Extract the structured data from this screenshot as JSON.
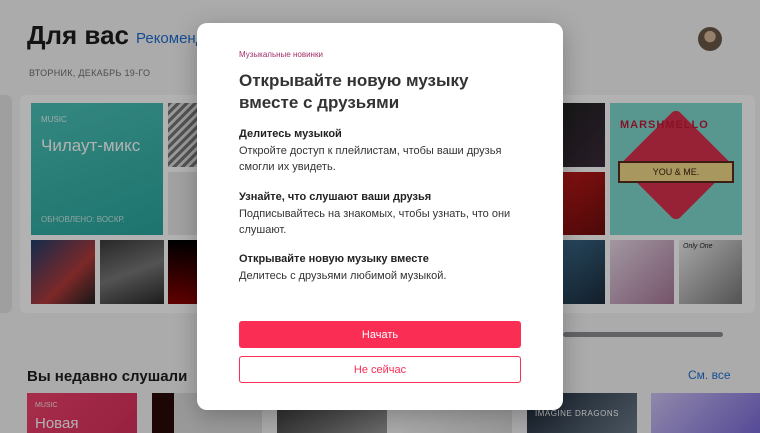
{
  "page": {
    "title": "Для вас",
    "tab_recommendations": "Рекомендации",
    "date": "ВТОРНИК, ДЕКАБРЬ 19-ГО",
    "mix": {
      "brand": "MUSIC",
      "name": "Чилаут-микс",
      "updated": "ОБНОВЛЕНО: ВОСКР."
    },
    "album_marshmello": {
      "word": "MARSHMELLO",
      "ribbon": "YOU & ME."
    },
    "album_only_one": "Only One",
    "recent_title": "Вы недавно слушали",
    "see_all": "См. все",
    "recent_mix": {
      "brand": "MUSIC",
      "name": "Новая"
    },
    "recent_band": "IMAGINE DRAGONS"
  },
  "modal": {
    "eyebrow": "Музыкальные новинки",
    "headline": "Открывайте новую музыку вместе с друзьями",
    "features": [
      {
        "title": "Делитесь музыкой",
        "desc": "Откройте доступ к плейлистам, чтобы ваши друзья смогли их увидеть."
      },
      {
        "title": "Узнайте, что слушают ваши друзья",
        "desc": "Подписывайтесь на знакомых, чтобы узнать, что они слушают."
      },
      {
        "title": "Открывайте новую музыку вместе",
        "desc": "Делитесь с друзьями любимой музыкой."
      }
    ],
    "start_label": "Начать",
    "later_label": "Не сейчас"
  },
  "colors": {
    "accent": "#fa2d55",
    "link": "#1f6fd1",
    "overlay": "rgba(0,0,0,0.30)"
  }
}
